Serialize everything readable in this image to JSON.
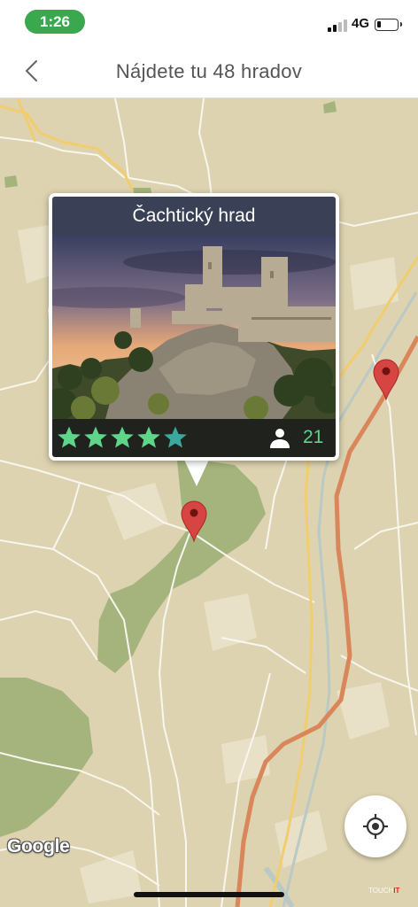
{
  "status_bar": {
    "time": "1:26",
    "network": "4G",
    "battery_level": 0.2,
    "signal_bars": 2
  },
  "nav": {
    "back_icon": "chevron-left-icon",
    "title": "Nájdete tu 48 hradov"
  },
  "map": {
    "attribution": "Google",
    "watermark": {
      "text": "TOUCH",
      "accent": "IT"
    },
    "colors": {
      "land": "#ddd3b0",
      "forest": "#a4b47c",
      "highway": "#d9865a",
      "road": "#f2cd6e",
      "marker": "#d64541"
    }
  },
  "popup": {
    "title": "Čachtický hrad",
    "rating": 4.5,
    "rating_max": 5,
    "visitor_count": "21",
    "star_color": "#5fd58a",
    "star_half_color": "#3ba8a0"
  },
  "controls": {
    "locate_icon": "my-location-icon"
  }
}
